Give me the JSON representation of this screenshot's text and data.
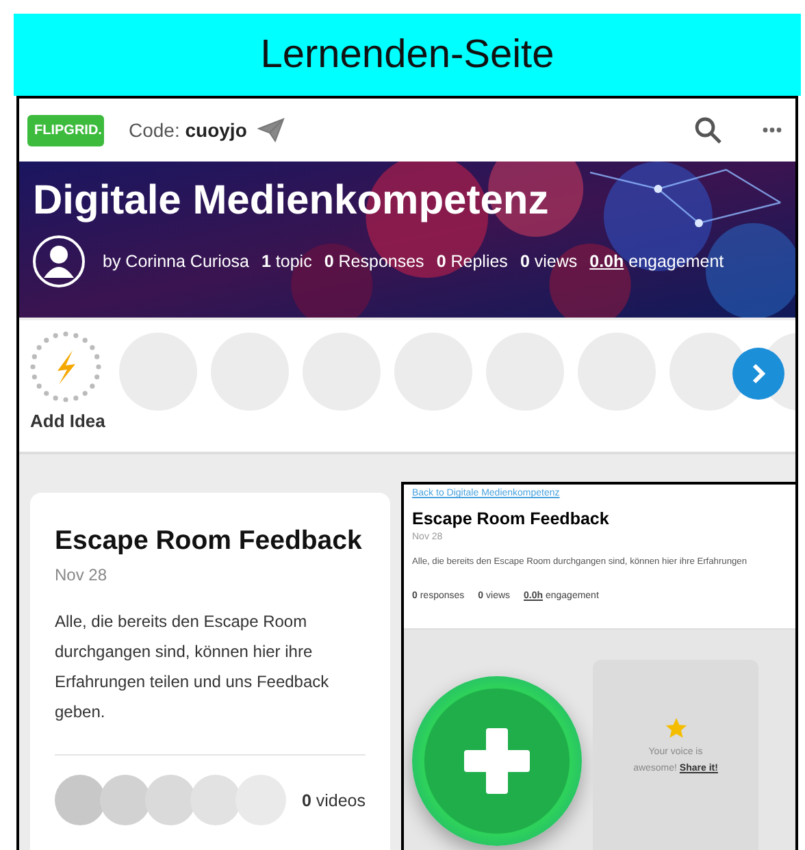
{
  "page_title": "Lernenden-Seite",
  "header": {
    "logo": "FLIPGRID.",
    "code_label": "Code:",
    "code": "cuoyjo"
  },
  "banner": {
    "kind": "picture",
    "title": "Digitale Medienkompetenz",
    "author": "by Corinna Curiosa",
    "stats": [
      {
        "text": "**1** topic",
        "underlined": false
      },
      {
        "text": "**0** Responses",
        "underlined": false
      },
      {
        "text": "**0** Replies",
        "underlined": false
      },
      {
        "text": "**0** views",
        "underlined": false
      },
      {
        "text": "**0.0h** engagement",
        "underlined": true
      }
    ]
  },
  "ideas": {
    "add_label": "Add Idea"
  },
  "topic_card": {
    "title": "Escape Room Feedback",
    "date": "Nov 28",
    "description": "Alle, die bereits den Escape Room durchgangen sind, können hier ihre Erfahrungen teilen und uns Feedback geben.",
    "videos_count": "0",
    "videos_label": "videos"
  },
  "preview": {
    "back_link": "Back to Digitale Medienkompetenz",
    "title": "Escape Room Feedback",
    "date": "Nov 28",
    "description": "Alle, die bereits den Escape Room durchgangen sind, können hier ihre Erfahrungen",
    "stats": [
      {
        "text": "**0** responses",
        "underlined": false
      },
      {
        "text": "**0** views",
        "underlined": false
      },
      {
        "text": "**0.0h** engagement",
        "underlined": true
      }
    ],
    "tip": {
      "text": "Your voice is awesome!",
      "link": "Share it!"
    }
  }
}
